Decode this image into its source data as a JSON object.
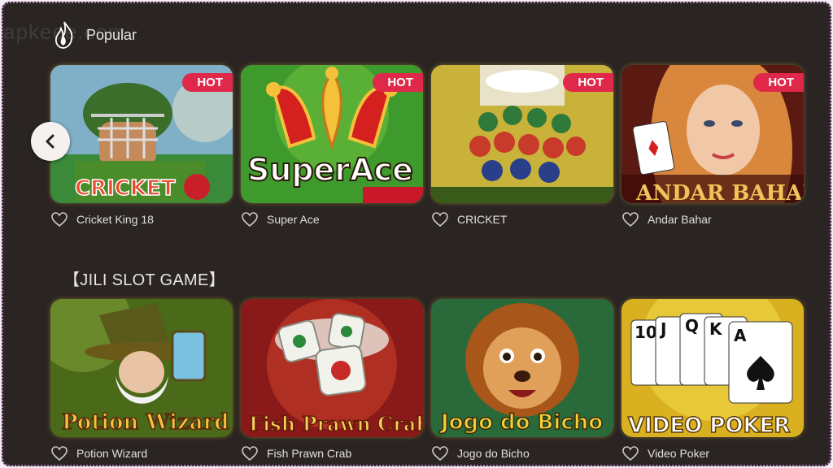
{
  "watermark": "apkeee.com",
  "popular": {
    "title": "Popular",
    "games": [
      {
        "name": "Cricket King 18",
        "badge": "HOT",
        "art_text": "CRICKET"
      },
      {
        "name": "Super Ace",
        "badge": "HOT",
        "art_text": "SuperAce"
      },
      {
        "name": "CRICKET",
        "badge": "HOT",
        "art_text": "CRICKET"
      },
      {
        "name": "Andar Bahar",
        "badge": "HOT",
        "art_text": "ANDAR BAHAR"
      }
    ]
  },
  "jili": {
    "title": "【JILI SLOT GAME】",
    "games": [
      {
        "name": "Potion Wizard",
        "art_text": "Potion Wizard"
      },
      {
        "name": "Fish Prawn Crab",
        "art_text": "Fish Prawn Crab"
      },
      {
        "name": "Jogo do Bicho",
        "art_text": "Jogo do Bicho"
      },
      {
        "name": "Video Poker",
        "art_text": "VIDEO POKER",
        "cards": [
          "10",
          "J",
          "Q",
          "K",
          "A"
        ]
      }
    ]
  },
  "colors": {
    "background": "#2a2522",
    "hot_badge": "#e0284a",
    "text": "#e4dfda"
  }
}
